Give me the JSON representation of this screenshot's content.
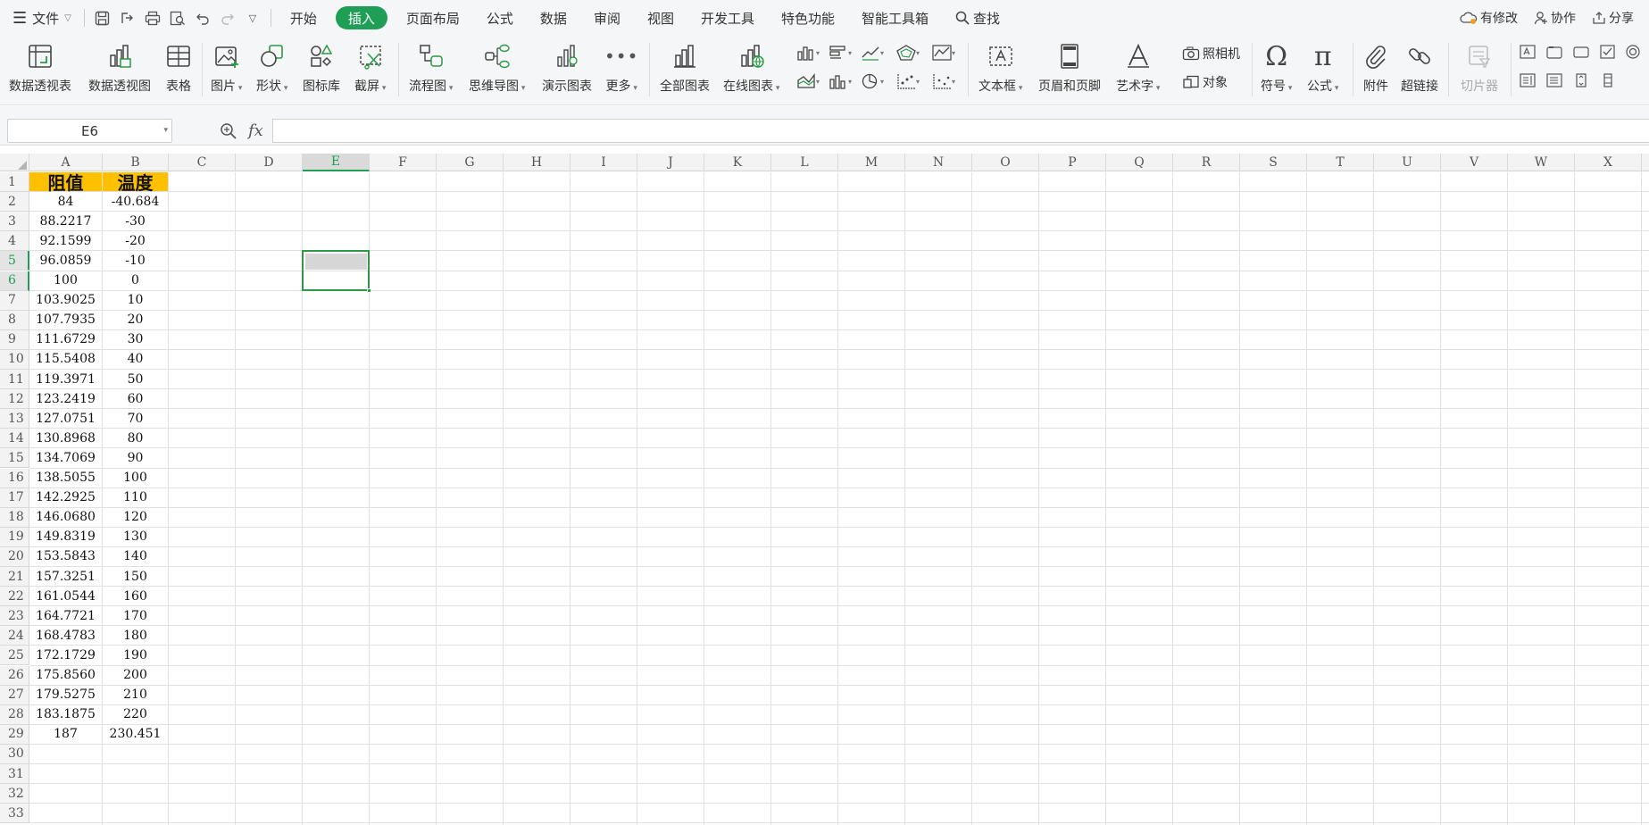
{
  "menu": {
    "file_label": "文件",
    "tabs": [
      "开始",
      "插入",
      "页面布局",
      "公式",
      "数据",
      "审阅",
      "视图",
      "开发工具",
      "特色功能",
      "智能工具箱"
    ],
    "active_tab": "插入",
    "search_label": "查找",
    "right": {
      "modified": "有修改",
      "collab": "协作",
      "share": "分享"
    }
  },
  "ribbon": {
    "pivot_table": "数据透视表",
    "pivot_chart": "数据透视图",
    "table": "表格",
    "picture": "图片",
    "shape": "形状",
    "icon_lib": "图标库",
    "screenshot": "截屏",
    "flowchart": "流程图",
    "mindmap": "思维导图",
    "present_chart": "演示图表",
    "more": "更多",
    "all_charts": "全部图表",
    "online_charts": "在线图表",
    "textbox": "文本框",
    "header_footer": "页眉和页脚",
    "wordart": "艺术字",
    "camera": "照相机",
    "object": "对象",
    "symbol": "符号",
    "formula": "公式",
    "attachment": "附件",
    "hyperlink": "超链接",
    "slicer": "切片器"
  },
  "formula_bar": {
    "name_box": "E6",
    "fx": "fx",
    "value": ""
  },
  "columns": [
    "A",
    "B",
    "C",
    "D",
    "E",
    "F",
    "G",
    "H",
    "I",
    "J",
    "K",
    "L",
    "M",
    "N",
    "O",
    "P",
    "Q",
    "R",
    "S",
    "T",
    "U",
    "V",
    "W",
    "X"
  ],
  "selected_column": "E",
  "selected_rows": [
    5,
    6
  ],
  "rows": [
    1,
    2,
    3,
    4,
    5,
    6,
    7,
    8,
    9,
    10,
    11,
    12,
    13,
    14,
    15,
    16,
    17,
    18,
    19,
    20,
    21,
    22,
    23,
    24,
    25,
    26,
    27,
    28,
    29,
    30,
    31,
    32,
    33
  ],
  "sheet": {
    "header": [
      "阻值",
      "温度"
    ],
    "data": [
      [
        "84",
        "-40.684"
      ],
      [
        "88.2217",
        "-30"
      ],
      [
        "92.1599",
        "-20"
      ],
      [
        "96.0859",
        "-10"
      ],
      [
        "100",
        "0"
      ],
      [
        "103.9025",
        "10"
      ],
      [
        "107.7935",
        "20"
      ],
      [
        "111.6729",
        "30"
      ],
      [
        "115.5408",
        "40"
      ],
      [
        "119.3971",
        "50"
      ],
      [
        "123.2419",
        "60"
      ],
      [
        "127.0751",
        "70"
      ],
      [
        "130.8968",
        "80"
      ],
      [
        "134.7069",
        "90"
      ],
      [
        "138.5055",
        "100"
      ],
      [
        "142.2925",
        "110"
      ],
      [
        "146.0680",
        "120"
      ],
      [
        "149.8319",
        "130"
      ],
      [
        "153.5843",
        "140"
      ],
      [
        "157.3251",
        "150"
      ],
      [
        "161.0544",
        "160"
      ],
      [
        "164.7721",
        "170"
      ],
      [
        "168.4783",
        "180"
      ],
      [
        "172.1729",
        "190"
      ],
      [
        "175.8560",
        "200"
      ],
      [
        "179.5275",
        "210"
      ],
      [
        "183.1875",
        "220"
      ],
      [
        "187",
        "230.451"
      ]
    ]
  },
  "colors": {
    "accent": "#1f9e56",
    "header_fill": "#ffc000",
    "selection": "#2a9a44"
  }
}
